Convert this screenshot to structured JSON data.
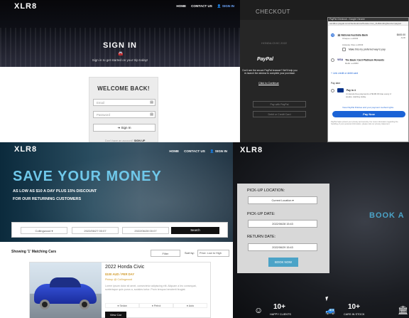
{
  "signin": {
    "logo": "XLR8",
    "nav": [
      "HOME",
      "CONTACT US",
      "SIGN IN"
    ],
    "title": "SIGN IN",
    "subtitle": "Sign in to get started on your trip today!",
    "card_title": "WELCOME BACK!",
    "email_placeholder": "Email",
    "password_placeholder": "Password",
    "button": "Sign In",
    "footer_text": "Don't have an account?",
    "footer_link": "SIGN UP"
  },
  "checkout": {
    "title": "CHECKOUT",
    "detail_line": "HONDA CIVIC 2022",
    "paypal_logo": "PayPal",
    "paypal_text": "Don't see the secure PayPal browser? We'll help you re-launch the window to complete your purchase.",
    "continue": "Click to Continue",
    "button_1": "Pay with PayPal",
    "button_2": "Debit or Credit Card",
    "popup": {
      "window_title": "PayPal Checkout - Google Chrome",
      "url": "sandbox.paypal.com/checkoutnow?locale.x=en_AU&fundingSource=paypal",
      "bank_name": "National Australia Bank",
      "bank_type": "Cheque ••••0043",
      "bank_amount": "$400.00",
      "bank_amount_sub": "AUD",
      "autopay": "Autopay Visa ••••0043",
      "preferred": "Make this my preferred way to pay",
      "card_name": "The Basic Card Platinum Rewards",
      "card_type": "Debit ••••0063",
      "link_more": "+ Link credit or debit card",
      "pay_later": "Pay later",
      "pay_in_4": "Pay in 4",
      "pay_in_4_desc": "4 interest-free payments of $100.00 due every 2 weeks, starting today.",
      "policies": "View PayPal Policies and your payment method rights.",
      "pay_now": "Pay Now",
      "fine_print": "PayPal helps protect your privacy and security. For more information regarding the handling of your personal information, please visit our privacy statement."
    }
  },
  "browse": {
    "logo": "XLR8",
    "nav": [
      "HOME",
      "CONTACT US",
      "SIGN IN"
    ],
    "headline": "SAVE YOUR MONEY",
    "line1": "AS LOW AS $10 A DAY PLUS 15% DISCOUNT",
    "line2": "FOR OUR RETURNING CUSTOMERS",
    "location": "Collingwood",
    "date_from": "2022/06/27 00:07",
    "date_to": "2022/06/28 00:07",
    "search_button": "Search",
    "results": "Showing '1' Matching Cars",
    "filter": "Filter",
    "sort_label": "Sort by:",
    "sort_value": "Price: Low to High",
    "car": {
      "name": "2022 Honda Civic",
      "price": "$100 AUD / PER DAY",
      "pickup": "Pickup @ Collingwood",
      "description": "Lorem ipsum dolor sit amet, consectetur adipiscing elit. Aliquam a leo consequat, scelerisque quis purus a, sodales tortor. Proin tempus hendrerit feugiat.",
      "features": [
        "Sedan",
        "Petrol",
        "Auto"
      ],
      "button": "View Car"
    }
  },
  "booking": {
    "logo": "XLR8",
    "pickup_label": "PICK-UP LOCATION:",
    "pickup_value": "Current Location",
    "pickup_date_label": "PICK-UP DATE:",
    "pickup_date_value": "2022/06/28 15:43",
    "return_date_label": "RETURN DATE:",
    "return_date_value": "2022/06/29 15:43",
    "book_button": "BOOK NOW",
    "promo": "BOOK A",
    "stats": [
      {
        "value": "10+",
        "label": "HAPPY CLIENTS",
        "icon": "smile-icon"
      },
      {
        "value": "10+",
        "label": "CARS IN STOCK",
        "icon": "car-icon"
      }
    ]
  }
}
